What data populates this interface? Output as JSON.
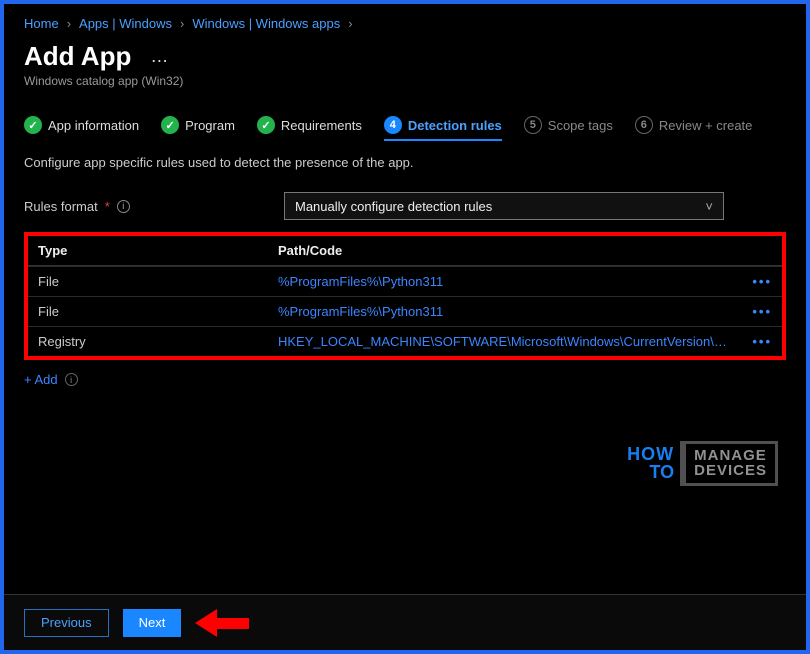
{
  "breadcrumb": {
    "items": [
      {
        "label": "Home"
      },
      {
        "label": "Apps | Windows"
      },
      {
        "label": "Windows | Windows apps"
      }
    ]
  },
  "header": {
    "title": "Add App",
    "more": "…",
    "subtitle": "Windows catalog app (Win32)"
  },
  "stepper": {
    "steps": [
      {
        "label": "App information",
        "state": "done",
        "num": "✓"
      },
      {
        "label": "Program",
        "state": "done",
        "num": "✓"
      },
      {
        "label": "Requirements",
        "state": "done",
        "num": "✓"
      },
      {
        "label": "Detection rules",
        "state": "active",
        "num": "4"
      },
      {
        "label": "Scope tags",
        "state": "pending",
        "num": "5"
      },
      {
        "label": "Review + create",
        "state": "pending",
        "num": "6"
      }
    ]
  },
  "blurb": "Configure app specific rules used to detect the presence of the app.",
  "form": {
    "rules_format_label": "Rules format",
    "required_star": "*",
    "info_glyph": "i",
    "rules_format_value": "Manually configure detection rules"
  },
  "table": {
    "headers": {
      "type": "Type",
      "path": "Path/Code"
    },
    "rows": [
      {
        "type": "File",
        "path": "%ProgramFiles%\\Python311"
      },
      {
        "type": "File",
        "path": "%ProgramFiles%\\Python311"
      },
      {
        "type": "Registry",
        "path": "HKEY_LOCAL_MACHINE\\SOFTWARE\\Microsoft\\Windows\\CurrentVersion\\Unins…"
      }
    ],
    "row_menu": "•••"
  },
  "add_link": "+ Add",
  "footer": {
    "previous": "Previous",
    "next": "Next"
  },
  "watermark": {
    "how": "HOW",
    "to": "TO",
    "manage": "MANAGE",
    "devices": "DEVICES"
  }
}
